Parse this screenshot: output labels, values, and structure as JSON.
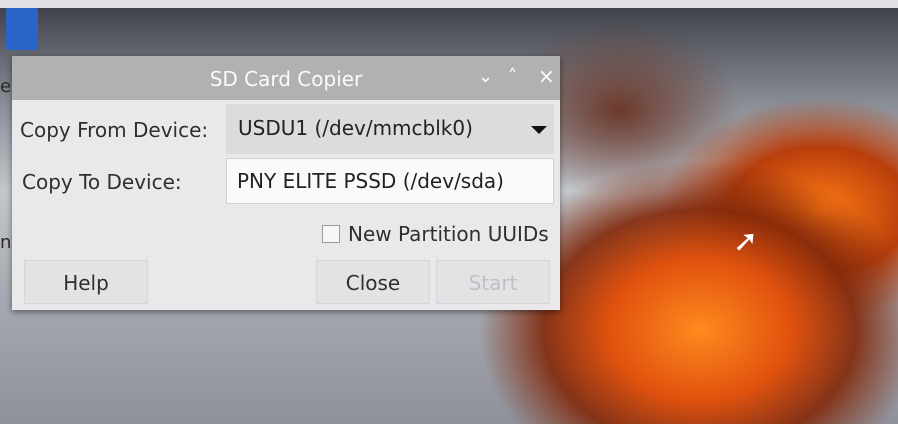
{
  "window": {
    "title": "SD Card Copier",
    "controls": {
      "minimize": "⌄",
      "maximize": "˄",
      "close": "×"
    }
  },
  "form": {
    "copy_from_label": "Copy From Device:",
    "copy_from_value": "USDU1  (/dev/mmcblk0)",
    "copy_to_label": "Copy To Device:",
    "copy_to_value": "PNY ELITE PSSD  (/dev/sda)",
    "new_uuids_label": "New Partition UUIDs",
    "new_uuids_checked": false
  },
  "buttons": {
    "help": "Help",
    "close": "Close",
    "start": "Start"
  },
  "desktop": {
    "partial_text_1": "e",
    "partial_text_2": "nt"
  },
  "icons": {
    "dropdown_arrow": "chevron-down-icon",
    "cursor": "mouse-pointer-icon"
  }
}
